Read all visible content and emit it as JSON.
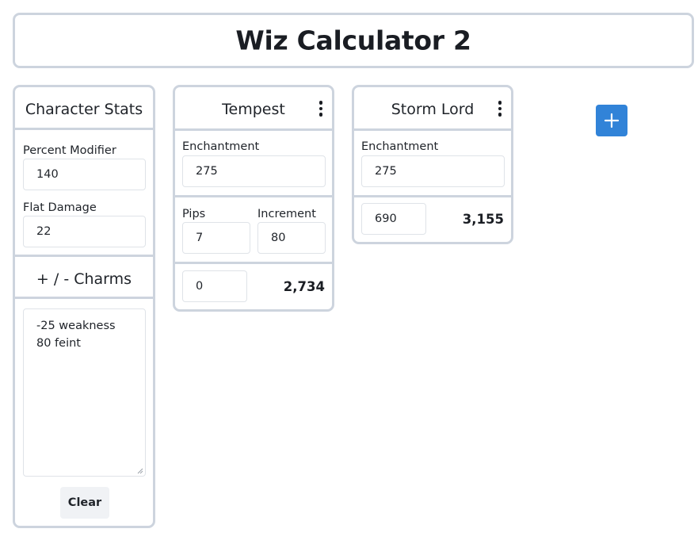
{
  "app": {
    "title": "Wiz Calculator 2"
  },
  "character_stats": {
    "title": "Character Stats",
    "percent_modifier_label": "Percent Modifier",
    "percent_modifier_value": "140",
    "flat_damage_label": "Flat Damage",
    "flat_damage_value": "22"
  },
  "charms": {
    "title": "+ / - Charms",
    "lines": [
      "-25 weakness",
      "80 feint"
    ],
    "clear_label": "Clear"
  },
  "spells": [
    {
      "name": "Tempest",
      "enchantment_label": "Enchantment",
      "enchantment_value": "275",
      "pips_label": "Pips",
      "pips_value": "7",
      "increment_label": "Increment",
      "increment_value": "80",
      "base_value": "0",
      "result": "2,734"
    },
    {
      "name": "Storm Lord",
      "enchantment_label": "Enchantment",
      "enchantment_value": "275",
      "base_value": "690",
      "result": "3,155"
    }
  ],
  "add_button": {
    "icon": "plus-icon",
    "color": "#3183d8"
  },
  "colors": {
    "border": "#cdd4de",
    "accent": "#3183d8",
    "clear_bg": "#f0f2f5"
  }
}
